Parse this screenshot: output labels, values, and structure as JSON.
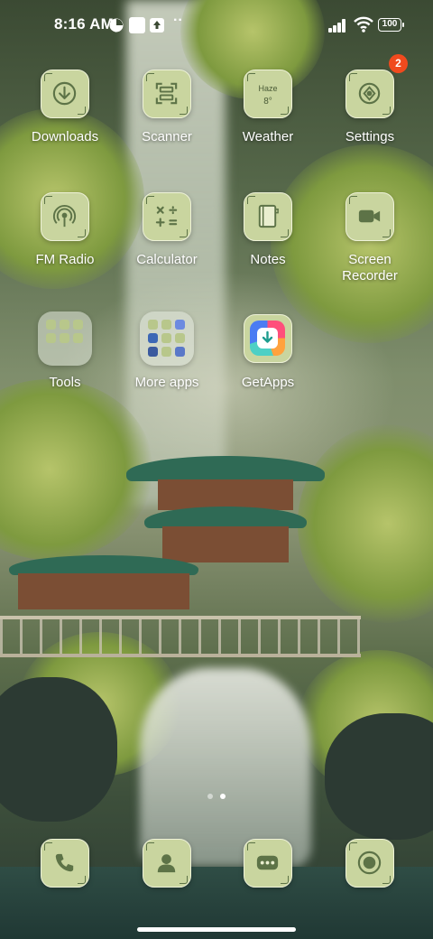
{
  "status_bar": {
    "time": "8:16 AM",
    "battery": "100",
    "overflow": "··"
  },
  "apps": [
    {
      "label": "Downloads",
      "icon": "download-icon"
    },
    {
      "label": "Scanner",
      "icon": "scanner-icon"
    },
    {
      "label": "Weather",
      "icon": "weather-icon",
      "condition": "Haze",
      "temperature": "8°"
    },
    {
      "label": "Settings",
      "icon": "gear-icon",
      "badge": "2"
    },
    {
      "label": "FM Radio",
      "icon": "radio-icon"
    },
    {
      "label": "Calculator",
      "icon": "calculator-icon"
    },
    {
      "label": "Notes",
      "icon": "notes-icon"
    },
    {
      "label": "Screen Recorder",
      "icon": "video-camera-icon"
    },
    {
      "label": "Tools",
      "icon": "folder-icon"
    },
    {
      "label": "More apps",
      "icon": "folder-icon"
    },
    {
      "label": "GetApps",
      "icon": "getapps-icon"
    }
  ],
  "dock": [
    {
      "name": "Phone",
      "icon": "phone-icon"
    },
    {
      "name": "Contacts",
      "icon": "contacts-icon"
    },
    {
      "name": "Messages",
      "icon": "messages-icon"
    },
    {
      "name": "Camera",
      "icon": "camera-icon"
    }
  ],
  "pager": {
    "pages": 2,
    "current": 2
  },
  "colors": {
    "icon_tile": "#c9d59f",
    "icon_glyph": "#5d7347",
    "badge": "#f04a1e"
  }
}
